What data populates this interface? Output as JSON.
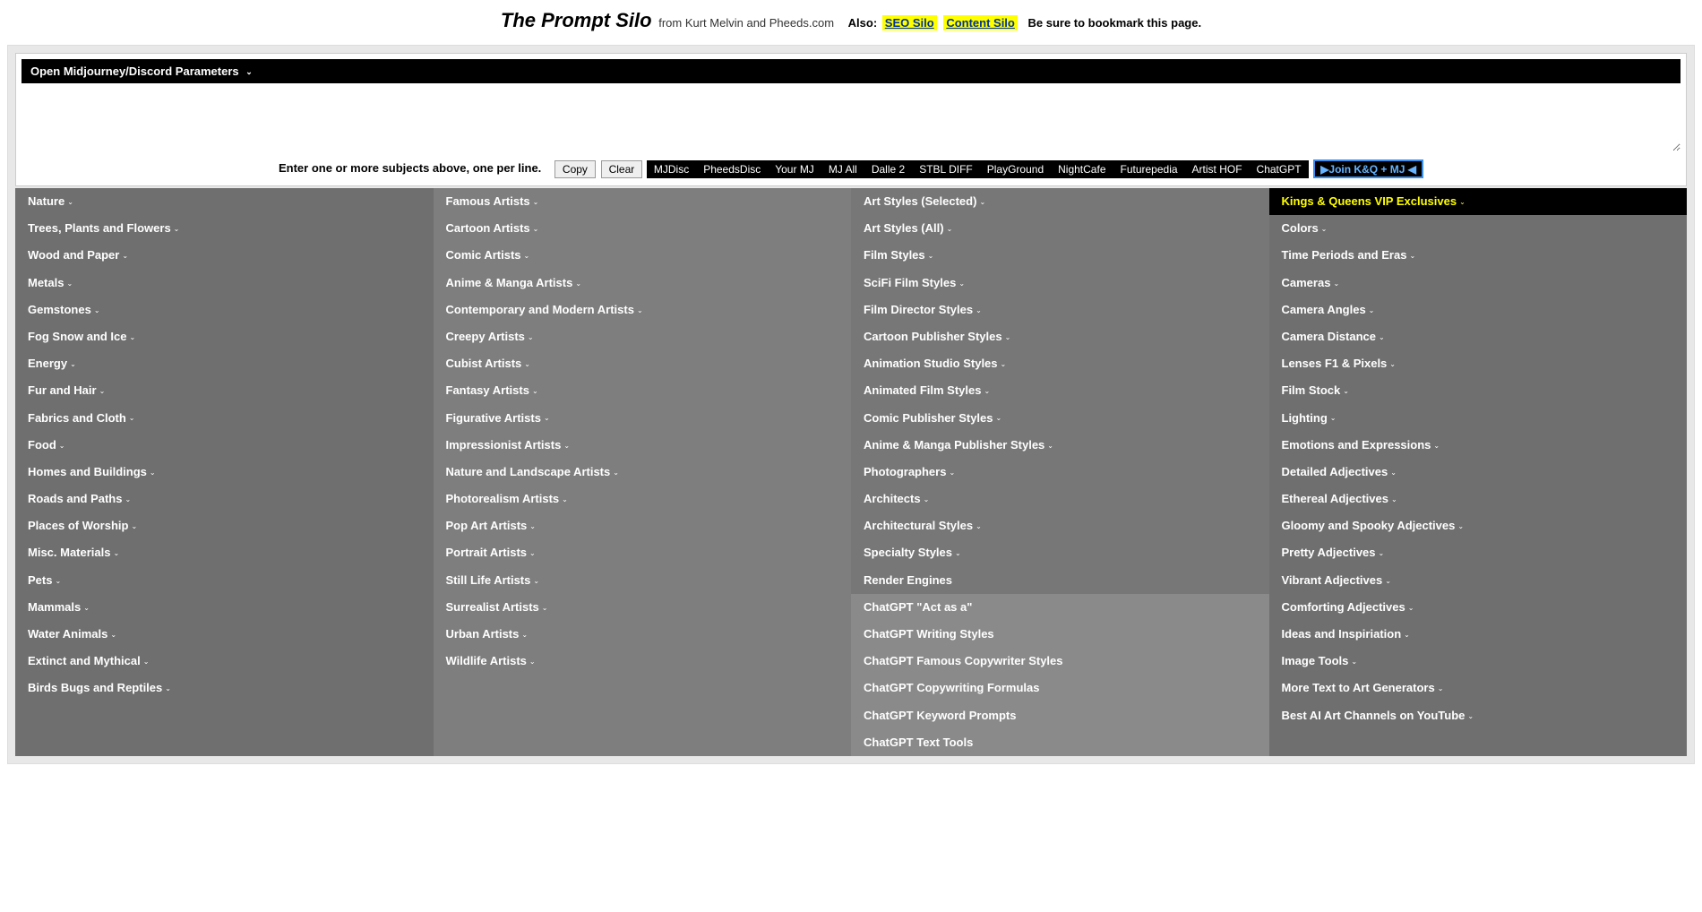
{
  "header": {
    "title": "The Prompt Silo",
    "subtitle": "from Kurt Melvin and Pheeds.com",
    "also_label": "Also:",
    "seo_link": "SEO Silo",
    "content_link": "Content Silo",
    "bookmark": "Be sure to bookmark this page."
  },
  "params_bar": "Open Midjourney/Discord Parameters",
  "toolbar": {
    "instructions": "Enter one or more subjects above, one per line.",
    "copy": "Copy",
    "clear": "Clear",
    "links": [
      "MJDisc",
      "PheedsDisc",
      "Your MJ",
      "MJ All",
      "Dalle 2",
      "STBL DIFF",
      "PlayGround",
      "NightCafe",
      "Futurepedia",
      "Artist HOF",
      "ChatGPT"
    ],
    "join": "▶Join K&Q + MJ ◀"
  },
  "columns": [
    {
      "class": "col-a",
      "items": [
        {
          "t": "Nature",
          "c": true
        },
        {
          "t": "Trees, Plants and Flowers",
          "c": true
        },
        {
          "t": "Wood and Paper",
          "c": true
        },
        {
          "t": "Metals",
          "c": true
        },
        {
          "t": "Gemstones",
          "c": true
        },
        {
          "t": "Fog Snow and Ice",
          "c": true
        },
        {
          "t": "Energy",
          "c": true
        },
        {
          "t": "Fur and Hair",
          "c": true
        },
        {
          "t": "Fabrics and Cloth",
          "c": true
        },
        {
          "t": "Food",
          "c": true
        },
        {
          "t": "Homes and Buildings",
          "c": true
        },
        {
          "t": "Roads and Paths",
          "c": true
        },
        {
          "t": "Places of Worship",
          "c": true
        },
        {
          "t": "Misc. Materials",
          "c": true
        },
        {
          "t": "Pets",
          "c": true
        },
        {
          "t": "Mammals",
          "c": true
        },
        {
          "t": "Water Animals",
          "c": true
        },
        {
          "t": "Extinct and Mythical",
          "c": true
        },
        {
          "t": "Birds Bugs and Reptiles",
          "c": true
        }
      ]
    },
    {
      "class": "col-b",
      "items": [
        {
          "t": "Famous Artists",
          "c": true
        },
        {
          "t": "Cartoon Artists",
          "c": true
        },
        {
          "t": "Comic Artists",
          "c": true
        },
        {
          "t": "Anime & Manga Artists",
          "c": true
        },
        {
          "t": "Contemporary and Modern Artists",
          "c": true
        },
        {
          "t": "Creepy Artists",
          "c": true
        },
        {
          "t": "Cubist Artists",
          "c": true
        },
        {
          "t": "Fantasy Artists",
          "c": true
        },
        {
          "t": "Figurative Artists",
          "c": true
        },
        {
          "t": "Impressionist Artists",
          "c": true
        },
        {
          "t": "Nature and Landscape Artists",
          "c": true
        },
        {
          "t": "Photorealism Artists",
          "c": true
        },
        {
          "t": "Pop Art Artists",
          "c": true
        },
        {
          "t": "Portrait Artists",
          "c": true
        },
        {
          "t": "Still Life Artists",
          "c": true
        },
        {
          "t": "Surrealist Artists",
          "c": true
        },
        {
          "t": "Urban Artists",
          "c": true
        },
        {
          "t": "Wildlife Artists",
          "c": true
        }
      ]
    },
    {
      "class": "col-c",
      "items": [
        {
          "t": "Art Styles (Selected)",
          "c": true
        },
        {
          "t": "Art Styles (All)",
          "c": true
        },
        {
          "t": "Film Styles",
          "c": true
        },
        {
          "t": "SciFi Film Styles",
          "c": true
        },
        {
          "t": "Film Director Styles",
          "c": true
        },
        {
          "t": "Cartoon Publisher Styles",
          "c": true
        },
        {
          "t": "Animation Studio Styles",
          "c": true
        },
        {
          "t": "Animated Film Styles",
          "c": true
        },
        {
          "t": "Comic Publisher Styles",
          "c": true
        },
        {
          "t": "Anime & Manga Publisher Styles",
          "c": true
        },
        {
          "t": "Photographers",
          "c": true
        },
        {
          "t": "Architects",
          "c": true
        },
        {
          "t": "Architectural Styles",
          "c": true
        },
        {
          "t": "Specialty Styles",
          "c": true
        },
        {
          "t": "Render Engines",
          "c": false
        },
        {
          "t": "ChatGPT \"Act as a\"",
          "c": false,
          "alt": true
        },
        {
          "t": "ChatGPT Writing Styles",
          "c": false,
          "alt": true
        },
        {
          "t": "ChatGPT Famous Copywriter Styles",
          "c": false,
          "alt": true
        },
        {
          "t": "ChatGPT Copywriting Formulas",
          "c": false,
          "alt": true
        },
        {
          "t": "ChatGPT Keyword Prompts",
          "c": false,
          "alt": true
        },
        {
          "t": "ChatGPT Text Tools",
          "c": false,
          "alt": true
        }
      ]
    },
    {
      "class": "col-d",
      "items": [
        {
          "t": "Kings & Queens VIP Exclusives",
          "c": true,
          "vip": true
        },
        {
          "t": "Colors",
          "c": true
        },
        {
          "t": "Time Periods and Eras",
          "c": true
        },
        {
          "t": "Cameras",
          "c": true
        },
        {
          "t": "Camera Angles",
          "c": true
        },
        {
          "t": "Camera Distance",
          "c": true
        },
        {
          "t": "Lenses F1 & Pixels",
          "c": true
        },
        {
          "t": "Film Stock",
          "c": true
        },
        {
          "t": "Lighting",
          "c": true
        },
        {
          "t": "Emotions and Expressions",
          "c": true
        },
        {
          "t": "Detailed Adjectives",
          "c": true
        },
        {
          "t": "Ethereal Adjectives",
          "c": true
        },
        {
          "t": "Gloomy and Spooky Adjectives",
          "c": true
        },
        {
          "t": "Pretty Adjectives",
          "c": true
        },
        {
          "t": "Vibrant Adjectives",
          "c": true
        },
        {
          "t": "Comforting Adjectives",
          "c": true
        },
        {
          "t": "Ideas and Inspiriation",
          "c": true
        },
        {
          "t": "Image Tools",
          "c": true
        },
        {
          "t": "More Text to Art Generators",
          "c": true
        },
        {
          "t": "Best AI Art Channels on YouTube",
          "c": true
        }
      ]
    }
  ]
}
